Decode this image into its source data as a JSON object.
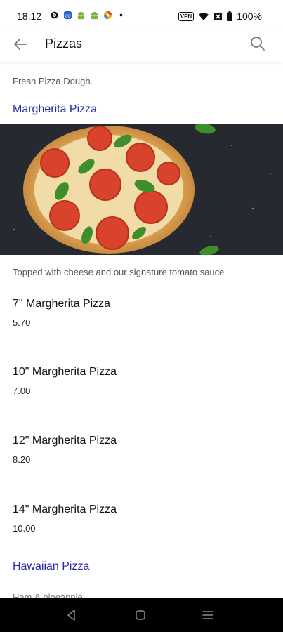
{
  "status": {
    "time": "18:12",
    "vpn": "VPN",
    "battery": "100%"
  },
  "header": {
    "title": "Pizzas",
    "back_icon": "arrow-left-icon",
    "search_icon": "search-icon"
  },
  "content": {
    "intro": "Fresh Pizza Dough.",
    "categories": [
      {
        "title": "Margherita Pizza",
        "image": "margherita-pizza-photo",
        "description": "Topped with cheese and our signature tomato sauce",
        "items": [
          {
            "name": "7\" Margherita Pizza",
            "price": "5.70"
          },
          {
            "name": "10\" Margherita Pizza",
            "price": "7.00"
          },
          {
            "name": "12\" Margherita Pizza",
            "price": "8.20"
          },
          {
            "name": "14\" Margherita Pizza",
            "price": "10.00"
          }
        ]
      },
      {
        "title": "Hawaiian Pizza",
        "description": "Ham & pineapple"
      }
    ]
  },
  "colors": {
    "accent": "#2a2aa8",
    "nav_background": "#000000"
  }
}
